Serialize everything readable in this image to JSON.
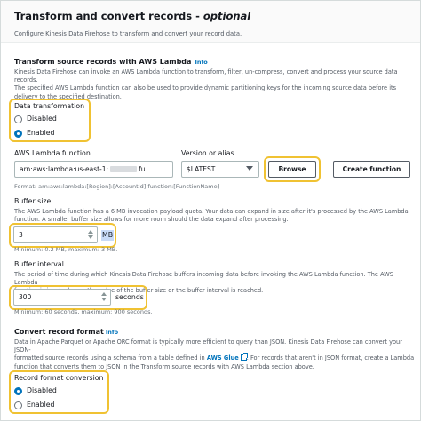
{
  "header": {
    "title": "Transform and convert records - ",
    "title_optional": "optional",
    "subtitle": "Configure Kinesis Data Firehose to transform and convert your record data."
  },
  "lambda_section": {
    "title": "Transform source records with AWS Lambda",
    "info": "Info",
    "description_1": "Kinesis Data Firehose can invoke an AWS Lambda function to transform, filter, un-compress, convert and process your source data records.",
    "description_2": "The specified AWS Lambda function can also be used to provide dynamic partitioning keys for the incoming source data before its delivery to the specified destination."
  },
  "data_transformation": {
    "label": "Data transformation",
    "options": [
      "Disabled",
      "Enabled"
    ],
    "selected": "Enabled"
  },
  "lambda_function": {
    "label": "AWS Lambda function",
    "value_prefix": "arn:aws:lambda:us-east-1:",
    "value_suffix": "fu",
    "format_hint": "Format: arn:aws:lambda:[Region]:[AccountId]:function:[FunctionName]"
  },
  "version": {
    "label": "Version or alias",
    "value": "$LATEST"
  },
  "buttons": {
    "browse": "Browse",
    "create_function": "Create function"
  },
  "buffer_size": {
    "label": "Buffer size",
    "description_1": "The AWS Lambda function has a 6 MB invocation payload quota. Your data can expand in size after it's processed by the AWS Lambda",
    "description_2": "function. A smaller buffer size allows for more room should the data expand after processing.",
    "value": "3",
    "unit": "MB",
    "hint": "Minimum: 0.2 MB, maximum: 3 MB."
  },
  "buffer_interval": {
    "label": "Buffer interval",
    "description_1": "The period of time during which Kinesis Data Firehose buffers incoming data before invoking the AWS Lambda function. The AWS Lambda",
    "description_2": "function is invoked once the value of the buffer size or the buffer interval is reached.",
    "value": "300",
    "unit": "seconds",
    "hint": "Minimum: 60 seconds, maximum: 900 seconds."
  },
  "convert_section": {
    "title": "Convert record format",
    "info": "Info",
    "description_1": "Data in Apache Parquet or Apache ORC format is typically more efficient to query than JSON. Kinesis Data Firehose can convert your JSON-",
    "description_2a": "formatted source records using a schema from a table defined in ",
    "glue_link": "AWS Glue",
    "description_2b": ". For records that aren't in JSON format, create a Lambda",
    "description_3": "function that converts them to JSON in the Transform source records with AWS Lambda section above."
  },
  "record_format_conversion": {
    "label": "Record format conversion",
    "options": [
      "Disabled",
      "Enabled"
    ],
    "selected": "Disabled"
  },
  "colors": {
    "highlight": "#f0c232",
    "link": "#0073bb",
    "radio_selected": "#0073bb"
  }
}
